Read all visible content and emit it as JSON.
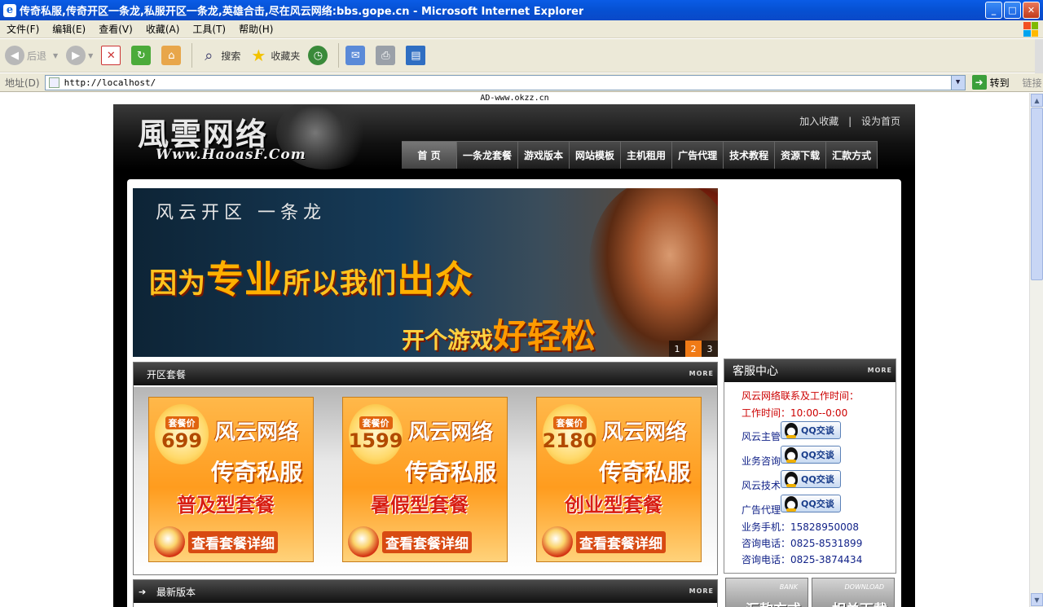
{
  "window": {
    "title": "传奇私服,传奇开区一条龙,私服开区一条龙,英雄合击,尽在风云网络:bbs.gope.cn - Microsoft Internet Explorer",
    "buttons": {
      "minimize": "_",
      "maximize": "□",
      "close": "✕"
    }
  },
  "menu": [
    "文件(F)",
    "编辑(E)",
    "查看(V)",
    "收藏(A)",
    "工具(T)",
    "帮助(H)"
  ],
  "toolbar": {
    "back": "后退",
    "search": "搜索",
    "favorites": "收藏夹"
  },
  "address": {
    "label": "地址(D)",
    "url": "http://localhost/",
    "go": "转到",
    "links": "链接"
  },
  "page": {
    "ad": "AD-www.okzz.cn",
    "logo": {
      "main": "風雲网络",
      "sub": "Www.HaoasF.Com"
    },
    "toplinks": [
      "加入收藏",
      "|",
      "设为首页"
    ],
    "nav": [
      "首 页",
      "一条龙套餐",
      "游戏版本",
      "网站模板",
      "主机租用",
      "广告代理",
      "技术教程",
      "资源下载",
      "汇款方式"
    ],
    "banner": {
      "line1": "风云开区 一条龙",
      "line2a": "因为",
      "line2b": "专业",
      "line2c": "所以我们",
      "line2d": "出众",
      "line3a": "开个游戏",
      "line3b": "好轻松",
      "pages": [
        "1",
        "2",
        "3"
      ],
      "active_page": "2"
    },
    "packages_panel": {
      "title": "开区套餐",
      "more": "MORE",
      "items": [
        {
          "badge": "套餐价",
          "price": "699",
          "brand": "风云网络",
          "genre": "传奇私服",
          "type": "普及型套餐",
          "detail": "查看套餐详细"
        },
        {
          "badge": "套餐价",
          "price": "1599",
          "brand": "风云网络",
          "genre": "传奇私服",
          "type": "暑假型套餐",
          "detail": "查看套餐详细"
        },
        {
          "badge": "套餐价",
          "price": "2180",
          "brand": "风云网络",
          "genre": "传奇私服",
          "type": "创业型套餐",
          "detail": "查看套餐详细"
        }
      ]
    },
    "versions_panel": {
      "title": "最新版本",
      "more": "MORE"
    },
    "service": {
      "title": "客服中心",
      "more": "MORE",
      "contact_title": "风云网络联系及工作时间：",
      "hours_label": "工作时间：",
      "hours": "10:00--0:00",
      "qq_label": "QQ交谈",
      "staff": [
        "风云主管",
        "业务咨询",
        "风云技术",
        "广告代理"
      ],
      "phones": [
        {
          "label": "业务手机：",
          "value": "15828950008"
        },
        {
          "label": "咨询电话：",
          "value": "0825-8531899"
        },
        {
          "label": "咨询电话：",
          "value": "0825-3874434"
        }
      ]
    },
    "bottom_buttons": [
      {
        "en": "BANK",
        "cn": "汇款方式"
      },
      {
        "en": "DOWNLOAD",
        "cn": "相关下载"
      }
    ]
  }
}
